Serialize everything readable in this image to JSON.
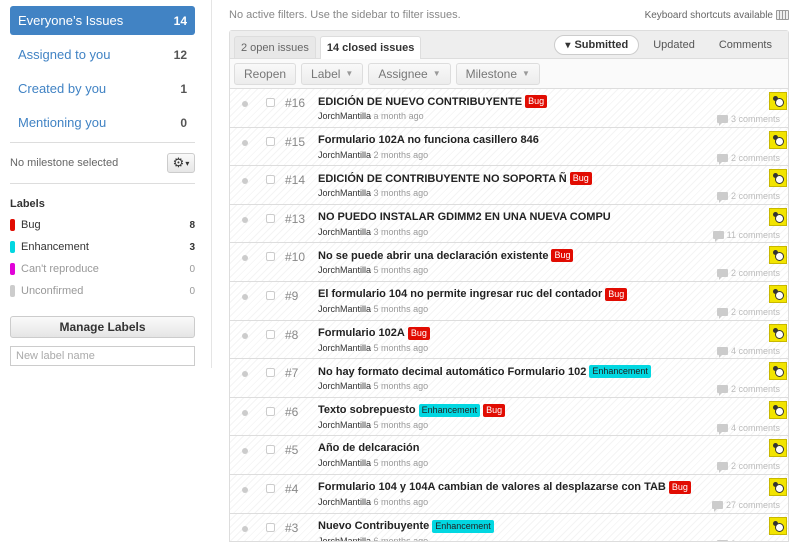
{
  "sidebar": {
    "filters": [
      {
        "label": "Everyone’s Issues",
        "count": "14"
      },
      {
        "label": "Assigned to you",
        "count": "12"
      },
      {
        "label": "Created by you",
        "count": "1"
      },
      {
        "label": "Mentioning you",
        "count": "0"
      }
    ],
    "milestone": "No milestone selected",
    "labels_title": "Labels",
    "labels": [
      {
        "name": "Bug",
        "count": "8",
        "color": "#e10c02"
      },
      {
        "name": "Enhancement",
        "count": "3",
        "color": "#02d7e1"
      },
      {
        "name": "Can't reproduce",
        "count": "0",
        "color": "#e102d8"
      },
      {
        "name": "Unconfirmed",
        "count": "0",
        "color": "#cccccc"
      }
    ],
    "manage_labels": "Manage Labels",
    "new_label_placeholder": "New label name"
  },
  "main": {
    "filter_message": "No active filters. Use the sidebar to filter issues.",
    "keyboard_shortcuts": "Keyboard shortcuts available",
    "state_tabs": [
      "2 open issues",
      "14 closed issues"
    ],
    "sort_tabs": [
      "Submitted",
      "Updated",
      "Comments"
    ],
    "actions": [
      "Reopen",
      "Label",
      "Assignee",
      "Milestone"
    ],
    "issues": [
      {
        "number": "#16",
        "title": "EDICIÓN DE NUEVO CONTRIBUYENTE",
        "labels": [
          "Bug"
        ],
        "user": "JorchMantilla",
        "time": "a month ago",
        "comments": "3 comments"
      },
      {
        "number": "#15",
        "title": "Formulario 102A no funciona casillero 846",
        "labels": [],
        "user": "JorchMantilla",
        "time": "2 months ago",
        "comments": "2 comments"
      },
      {
        "number": "#14",
        "title": "EDICIÓN DE CONTRIBUYENTE NO SOPORTA Ñ",
        "labels": [
          "Bug"
        ],
        "user": "JorchMantilla",
        "time": "3 months ago",
        "comments": "2 comments"
      },
      {
        "number": "#13",
        "title": "NO PUEDO INSTALAR GDIMM2 EN UNA NUEVA COMPU",
        "labels": [],
        "user": "JorchMantilla",
        "time": "3 months ago",
        "comments": "11 comments"
      },
      {
        "number": "#10",
        "title": "No se puede abrir una declaración existente",
        "labels": [
          "Bug"
        ],
        "user": "JorchMantilla",
        "time": "5 months ago",
        "comments": "2 comments"
      },
      {
        "number": "#9",
        "title": "El formulario 104 no permite ingresar ruc del contador",
        "labels": [
          "Bug"
        ],
        "user": "JorchMantilla",
        "time": "5 months ago",
        "comments": "2 comments"
      },
      {
        "number": "#8",
        "title": "Formulario 102A",
        "labels": [
          "Bug"
        ],
        "user": "JorchMantilla",
        "time": "5 months ago",
        "comments": "4 comments"
      },
      {
        "number": "#7",
        "title": "No hay formato decimal automático Formulario 102",
        "labels": [
          "Enhancement"
        ],
        "user": "JorchMantilla",
        "time": "5 months ago",
        "comments": "2 comments"
      },
      {
        "number": "#6",
        "title": "Texto sobrepuesto",
        "labels": [
          "Enhancement",
          "Bug"
        ],
        "user": "JorchMantilla",
        "time": "5 months ago",
        "comments": "4 comments"
      },
      {
        "number": "#5",
        "title": "Año de delcaración",
        "labels": [],
        "user": "JorchMantilla",
        "time": "5 months ago",
        "comments": "2 comments"
      },
      {
        "number": "#4",
        "title": "Formulario 104 y 104A cambian de valores al desplazarse con TAB",
        "labels": [
          "Bug"
        ],
        "user": "JorchMantilla",
        "time": "6 months ago",
        "comments": "27 comments"
      },
      {
        "number": "#3",
        "title": "Nuevo Contribuyente",
        "labels": [
          "Enhancement"
        ],
        "user": "JorchMantilla",
        "time": "6 months ago",
        "comments": "9 comments"
      }
    ]
  }
}
